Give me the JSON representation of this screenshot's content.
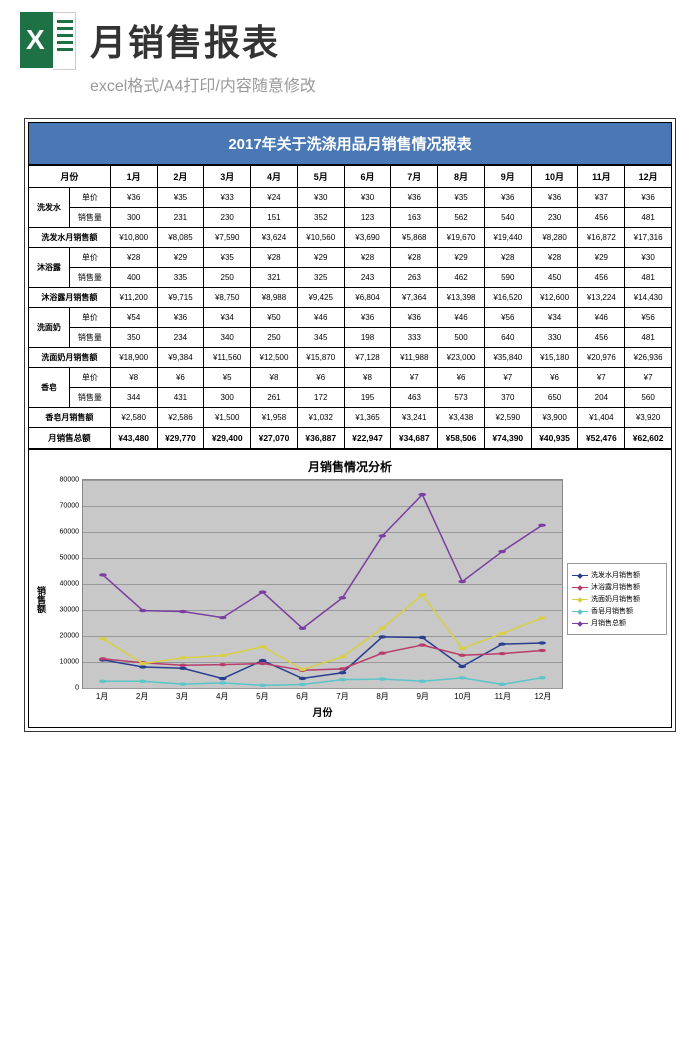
{
  "header": {
    "title": "月销售报表",
    "subtitle": "excel格式/A4打印/内容随意修改"
  },
  "doc_title": "2017年关于洗涤用品月销售情况报表",
  "months_header": "月份",
  "months": [
    "1月",
    "2月",
    "3月",
    "4月",
    "5月",
    "6月",
    "7月",
    "8月",
    "9月",
    "10月",
    "11月",
    "12月"
  ],
  "labels": {
    "unit_price": "单价",
    "volume": "销售量"
  },
  "products": [
    {
      "name": "洗发水",
      "price": [
        "¥36",
        "¥35",
        "¥33",
        "¥24",
        "¥30",
        "¥30",
        "¥36",
        "¥35",
        "¥36",
        "¥36",
        "¥37",
        "¥36"
      ],
      "volume": [
        "300",
        "231",
        "230",
        "151",
        "352",
        "123",
        "163",
        "562",
        "540",
        "230",
        "456",
        "481"
      ],
      "revenue_label": "洗发水月销售额",
      "revenue": [
        "¥10,800",
        "¥8,085",
        "¥7,590",
        "¥3,624",
        "¥10,560",
        "¥3,690",
        "¥5,868",
        "¥19,670",
        "¥19,440",
        "¥8,280",
        "¥16,872",
        "¥17,316"
      ]
    },
    {
      "name": "沐浴露",
      "price": [
        "¥28",
        "¥29",
        "¥35",
        "¥28",
        "¥29",
        "¥28",
        "¥28",
        "¥29",
        "¥28",
        "¥28",
        "¥29",
        "¥30"
      ],
      "volume": [
        "400",
        "335",
        "250",
        "321",
        "325",
        "243",
        "263",
        "462",
        "590",
        "450",
        "456",
        "481"
      ],
      "revenue_label": "沐浴露月销售额",
      "revenue": [
        "¥11,200",
        "¥9,715",
        "¥8,750",
        "¥8,988",
        "¥9,425",
        "¥6,804",
        "¥7,364",
        "¥13,398",
        "¥16,520",
        "¥12,600",
        "¥13,224",
        "¥14,430"
      ]
    },
    {
      "name": "洗面奶",
      "price": [
        "¥54",
        "¥36",
        "¥34",
        "¥50",
        "¥46",
        "¥36",
        "¥36",
        "¥46",
        "¥56",
        "¥34",
        "¥46",
        "¥56"
      ],
      "volume": [
        "350",
        "234",
        "340",
        "250",
        "345",
        "198",
        "333",
        "500",
        "640",
        "330",
        "456",
        "481"
      ],
      "revenue_label": "洗面奶月销售额",
      "revenue": [
        "¥18,900",
        "¥9,384",
        "¥11,560",
        "¥12,500",
        "¥15,870",
        "¥7,128",
        "¥11,988",
        "¥23,000",
        "¥35,840",
        "¥15,180",
        "¥20,976",
        "¥26,936"
      ]
    },
    {
      "name": "香皂",
      "price": [
        "¥8",
        "¥6",
        "¥5",
        "¥8",
        "¥6",
        "¥8",
        "¥7",
        "¥6",
        "¥7",
        "¥6",
        "¥7",
        "¥7"
      ],
      "volume": [
        "344",
        "431",
        "300",
        "261",
        "172",
        "195",
        "463",
        "573",
        "370",
        "650",
        "204",
        "560"
      ],
      "revenue_label": "香皂月销售额",
      "revenue": [
        "¥2,580",
        "¥2,586",
        "¥1,500",
        "¥1,958",
        "¥1,032",
        "¥1,365",
        "¥3,241",
        "¥3,438",
        "¥2,590",
        "¥3,900",
        "¥1,404",
        "¥3,920"
      ]
    }
  ],
  "total_label": "月销售总额",
  "totals": [
    "¥43,480",
    "¥29,770",
    "¥29,400",
    "¥27,070",
    "¥36,887",
    "¥22,947",
    "¥34,687",
    "¥58,506",
    "¥74,390",
    "¥40,935",
    "¥52,476",
    "¥62,602"
  ],
  "chart_data": {
    "type": "line",
    "title": "月销售情况分析",
    "xlabel": "月份",
    "ylabel": "销售额",
    "categories": [
      "1月",
      "2月",
      "3月",
      "4月",
      "5月",
      "6月",
      "7月",
      "8月",
      "9月",
      "10月",
      "11月",
      "12月"
    ],
    "ylim": [
      0,
      80000
    ],
    "y_ticks": [
      0,
      10000,
      20000,
      30000,
      40000,
      50000,
      60000,
      70000,
      80000
    ],
    "series": [
      {
        "name": "洗发水月销售额",
        "color": "#2a3e8f",
        "values": [
          10800,
          8085,
          7590,
          3624,
          10560,
          3690,
          5868,
          19670,
          19440,
          8280,
          16872,
          17316
        ]
      },
      {
        "name": "沐浴露月销售额",
        "color": "#b83d6b",
        "values": [
          11200,
          9715,
          8750,
          8988,
          9425,
          6804,
          7364,
          13398,
          16520,
          12600,
          13224,
          14430
        ]
      },
      {
        "name": "洗面奶月销售额",
        "color": "#d9d040",
        "values": [
          18900,
          9384,
          11560,
          12500,
          15870,
          7128,
          11988,
          23000,
          35840,
          15180,
          20976,
          26936
        ]
      },
      {
        "name": "香皂月销售额",
        "color": "#5bc5c9",
        "values": [
          2580,
          2586,
          1500,
          1958,
          1032,
          1365,
          3241,
          3438,
          2590,
          3900,
          1404,
          3920
        ]
      },
      {
        "name": "月销售总额",
        "color": "#7a3fa0",
        "values": [
          43480,
          29770,
          29400,
          27070,
          36887,
          22947,
          34687,
          58506,
          74390,
          40935,
          52476,
          62602
        ]
      }
    ],
    "legend_labels": [
      "洗发水月销售额",
      "沐浴露月销售额",
      "洗面奶月销售额",
      "香皂月销售额",
      "月销售总额"
    ]
  }
}
